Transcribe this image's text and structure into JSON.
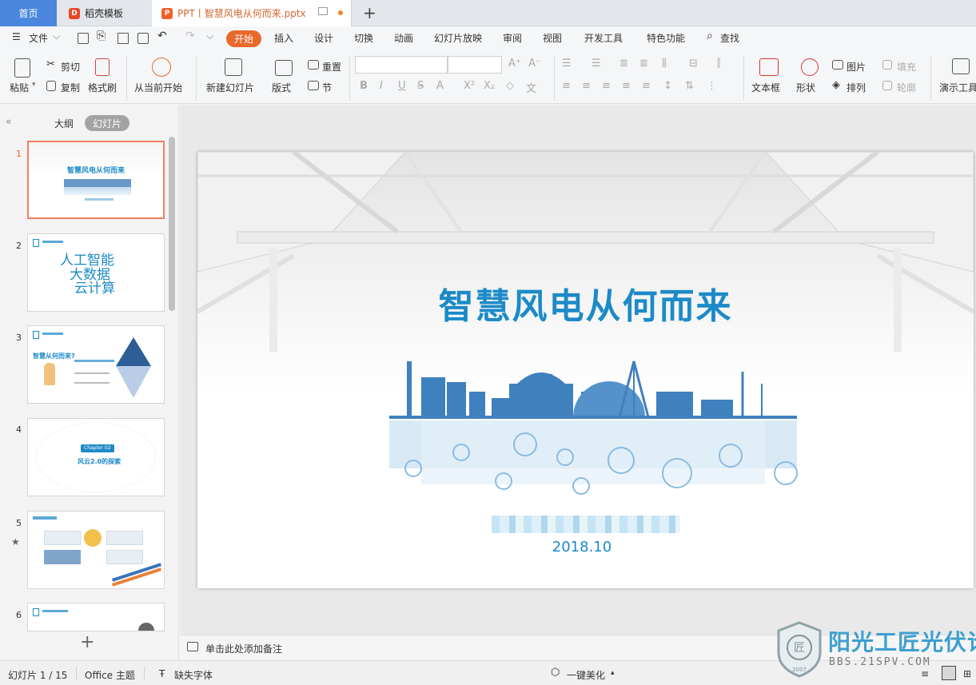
{
  "tabs": {
    "home": "首页",
    "templates": "稻壳模板",
    "document": "PPT丨智慧风电从何而来.pptx",
    "new_tab": "+"
  },
  "menu": {
    "file": "文件",
    "items": [
      "开始",
      "插入",
      "设计",
      "切换",
      "动画",
      "幻灯片放映",
      "审阅",
      "视图",
      "开发工具",
      "特色功能"
    ],
    "search": "查找"
  },
  "ribbon": {
    "paste": "粘贴",
    "cut": "剪切",
    "copy": "复制",
    "format_painter": "格式刷",
    "play_from_current": "从当前开始",
    "new_slide": "新建幻灯片",
    "layout": "版式",
    "reset": "重置",
    "section": "节",
    "textbox": "文本框",
    "shape": "形状",
    "picture": "图片",
    "fill": "填充",
    "arrange": "排列",
    "outline": "轮廓",
    "presentation_tool": "演示工具"
  },
  "left_panel": {
    "outline_tab": "大纲",
    "slides_tab": "幻灯片",
    "slides": [
      {
        "num": "1",
        "title": "智慧风电从何而来"
      },
      {
        "num": "2",
        "lines": [
          "人工智能",
          "大数据",
          "云计算"
        ]
      },
      {
        "num": "3",
        "title": "智慧从何而来?"
      },
      {
        "num": "4",
        "title": "风云2.0的探索",
        "chip": "Chapter 02"
      },
      {
        "num": "5"
      },
      {
        "num": "6"
      }
    ]
  },
  "slide": {
    "title": "智慧风电从何而来",
    "date": "2018.10"
  },
  "notes": {
    "placeholder": "单击此处添加备注"
  },
  "status": {
    "slide_count": "幻灯片 1 / 15",
    "theme": "Office 主题",
    "missing_fonts": "缺失字体",
    "beautify": "一键美化"
  },
  "watermark": {
    "name": "阳光工匠光伏论坛",
    "url": "BBS.21SPV.COM",
    "year": "2007"
  }
}
